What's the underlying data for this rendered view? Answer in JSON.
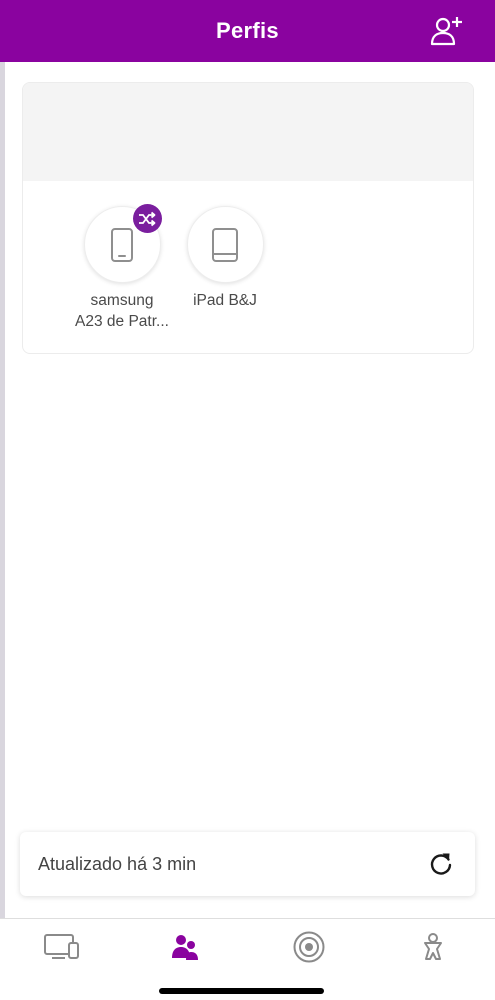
{
  "header": {
    "title": "Perfis",
    "action_icon": "add-user-icon",
    "background": "#8a039f"
  },
  "profile_card": {
    "devices": [
      {
        "name_line1": "samsung",
        "name_line2": "A23 de Patr...",
        "icon": "smartphone-icon",
        "badge_icon": "shuffle-icon",
        "badge_color": "#7a1e9e"
      },
      {
        "name_line1": "iPad B&J",
        "name_line2": "",
        "icon": "tablet-icon"
      }
    ]
  },
  "status": {
    "text": "Atualizado há 3 min",
    "action_icon": "refresh-icon"
  },
  "tabbar": {
    "tabs": [
      {
        "icon": "devices-icon",
        "active": false
      },
      {
        "icon": "profiles-icon",
        "active": true
      },
      {
        "icon": "broadcast-icon",
        "active": false
      },
      {
        "icon": "person-icon",
        "active": false
      }
    ],
    "active_color": "#8a039f",
    "inactive_color": "#8a8a8a"
  }
}
